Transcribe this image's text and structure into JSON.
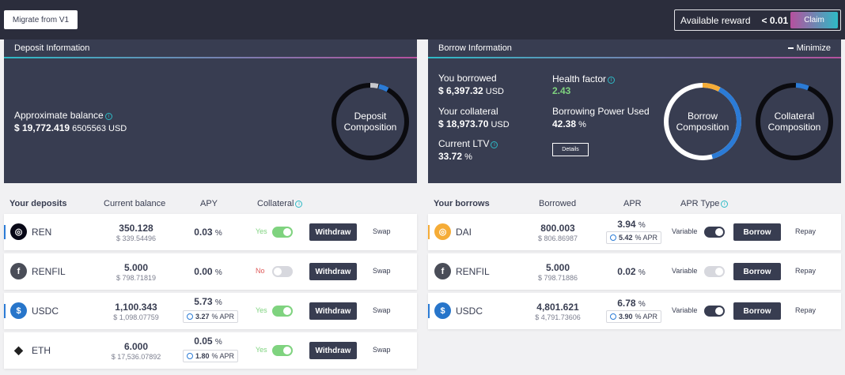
{
  "topbar": {
    "migrate_label": "Migrate from V1",
    "reward_label": "Available reward",
    "reward_value": "< 0.01",
    "claim_label": "Claim"
  },
  "deposit_panel": {
    "title": "Deposit Information",
    "balance_label": "Approximate balance",
    "balance_value_bold": "$ 19,772.419",
    "balance_value_rest": "6505563 USD",
    "ring_label_1": "Deposit",
    "ring_label_2": "Composition"
  },
  "borrow_panel": {
    "title": "Borrow Information",
    "minimize_label": "Minimize",
    "borrowed_label": "You borrowed",
    "borrowed_value": "$ 6,397.32",
    "borrowed_unit": "USD",
    "collateral_label": "Your collateral",
    "collateral_value": "$ 18,973.70",
    "collateral_unit": "USD",
    "ltv_label": "Current LTV",
    "ltv_value": "33.72",
    "ltv_unit": "%",
    "health_label": "Health factor",
    "health_value": "2.43",
    "power_label": "Borrowing Power Used",
    "power_value": "42.38",
    "power_unit": "%",
    "details_label": "Details",
    "borrow_ring_1": "Borrow",
    "borrow_ring_2": "Composition",
    "collateral_ring_1": "Collateral",
    "collateral_ring_2": "Composition"
  },
  "deposits_table": {
    "headers": [
      "Your deposits",
      "Current balance",
      "APY",
      "Collateral"
    ],
    "withdraw_label": "Withdraw",
    "swap_label": "Swap",
    "rows": [
      {
        "name": "REN",
        "icon": "ren-icon",
        "balance": "350.128",
        "usd": "$ 339.54496",
        "apy": "0.03",
        "pct": "%",
        "apr": "",
        "collateral": "Yes",
        "bar_color": "#2b7bd6",
        "icon_color": "#080817"
      },
      {
        "name": "RENFIL",
        "icon": "renfil-icon",
        "balance": "5.000",
        "usd": "$ 798.71819",
        "apy": "0.00",
        "pct": "%",
        "apr": "",
        "collateral": "No",
        "bar_color": "#fff",
        "icon_color": "#4a4d58"
      },
      {
        "name": "USDC",
        "icon": "usdc-icon",
        "balance": "1,100.343",
        "usd": "$ 1,098.07759",
        "apy": "5.73",
        "pct": "%",
        "apr": "3.27",
        "apr_unit": "% APR",
        "collateral": "Yes",
        "bar_color": "#2b7bd6",
        "icon_color": "#2775ca"
      },
      {
        "name": "ETH",
        "icon": "eth-icon",
        "balance": "6.000",
        "usd": "$ 17,536.07892",
        "apy": "0.05",
        "pct": "%",
        "apr": "1.80",
        "apr_unit": "% APR",
        "collateral": "Yes",
        "bar_color": "#fff",
        "icon_color": "#fff"
      }
    ]
  },
  "borrows_table": {
    "headers": [
      "Your borrows",
      "Borrowed",
      "APR",
      "APR Type"
    ],
    "borrow_label": "Borrow",
    "repay_label": "Repay",
    "variable_label": "Variable",
    "rows": [
      {
        "name": "DAI",
        "icon": "dai-icon",
        "borrowed": "800.003",
        "usd": "$ 806.86987",
        "apr": "3.94",
        "pct": "%",
        "reward_apr": "5.42",
        "apr_unit": "% APR",
        "bar_color": "#f5ac37",
        "icon_color": "#f5ac37",
        "toggle_on": true
      },
      {
        "name": "RENFIL",
        "icon": "renfil-icon",
        "borrowed": "5.000",
        "usd": "$ 798.71886",
        "apr": "0.02",
        "pct": "%",
        "reward_apr": "",
        "bar_color": "#fff",
        "icon_color": "#4a4d58",
        "toggle_on": false
      },
      {
        "name": "USDC",
        "icon": "usdc-icon",
        "borrowed": "4,801.621",
        "usd": "$ 4,791.73606",
        "apr": "6.78",
        "pct": "%",
        "reward_apr": "3.90",
        "apr_unit": "% APR",
        "bar_color": "#2b7bd6",
        "icon_color": "#2775ca",
        "toggle_on": true
      }
    ]
  },
  "colors": {
    "panel": "#383d51",
    "topbar": "#2b2d3c",
    "toggle_on": "#7fd37f",
    "toggle_dark": "#383d51",
    "health": "#7fd37f",
    "no_red": "#de5959"
  }
}
